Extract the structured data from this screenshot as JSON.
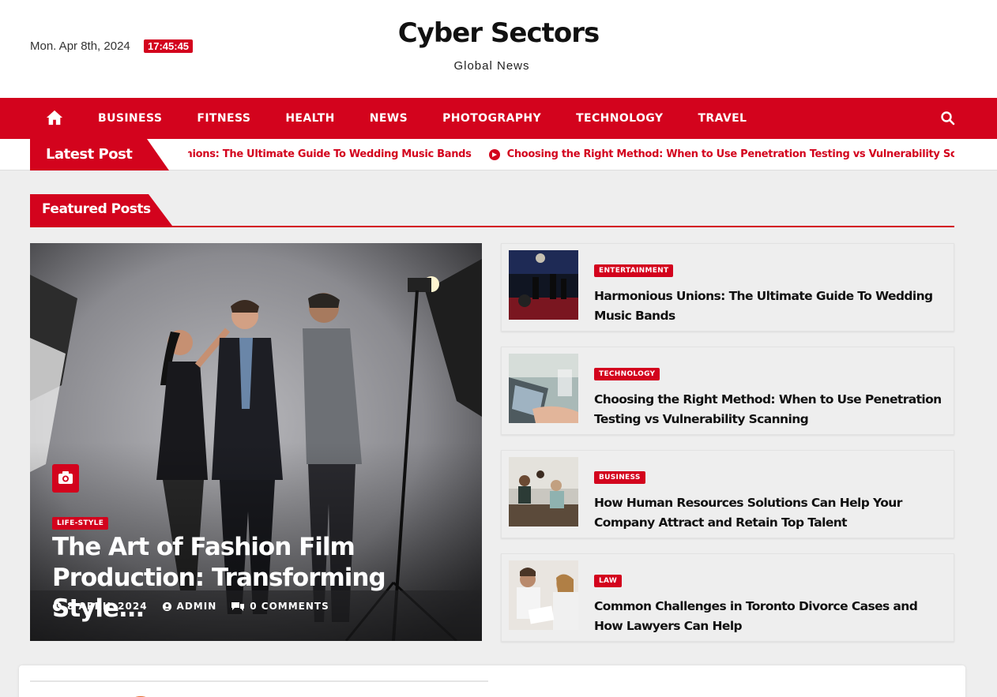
{
  "header": {
    "date": "Mon. Apr 8th, 2024",
    "time": "17:45:45",
    "site_title": "Cyber Sectors",
    "tagline": "Global News"
  },
  "nav": {
    "home_icon": "home-icon",
    "items": [
      "BUSINESS",
      "FITNESS",
      "HEALTH",
      "NEWS",
      "PHOTOGRAPHY",
      "TECHNOLOGY",
      "TRAVEL"
    ],
    "search_icon": "search-icon"
  },
  "latest": {
    "label": "Latest Post",
    "items": [
      "Inions: The Ultimate Guide To Wedding Music Bands",
      "Choosing the Right Method: When to Use Penetration Testing vs Vulnerability Scannin"
    ]
  },
  "featured": {
    "heading": "Featured Posts",
    "main": {
      "category": "LIFE-STYLE",
      "title": "The Art of Fashion Film Production: Transforming Style...",
      "date": "8 APRIL 2024",
      "author": "ADMIN",
      "comments": "0 COMMENTS",
      "format_icon": "camera-icon"
    },
    "posts": [
      {
        "category": "ENTERTAINMENT",
        "title": "Harmonious Unions: The Ultimate Guide To Wedding Music Bands"
      },
      {
        "category": "TECHNOLOGY",
        "title": "Choosing the Right Method: When to Use Penetration Testing vs Vulnerability Scanning"
      },
      {
        "category": "BUSINESS",
        "title": "How Human Resources Solutions Can Help Your Company Attract and Retain Top Talent"
      },
      {
        "category": "LAW",
        "title": "Common Challenges in Toronto Divorce Cases and How Lawyers Can Help"
      }
    ]
  },
  "colors": {
    "accent": "#d3031d",
    "background": "#eeeeee"
  }
}
